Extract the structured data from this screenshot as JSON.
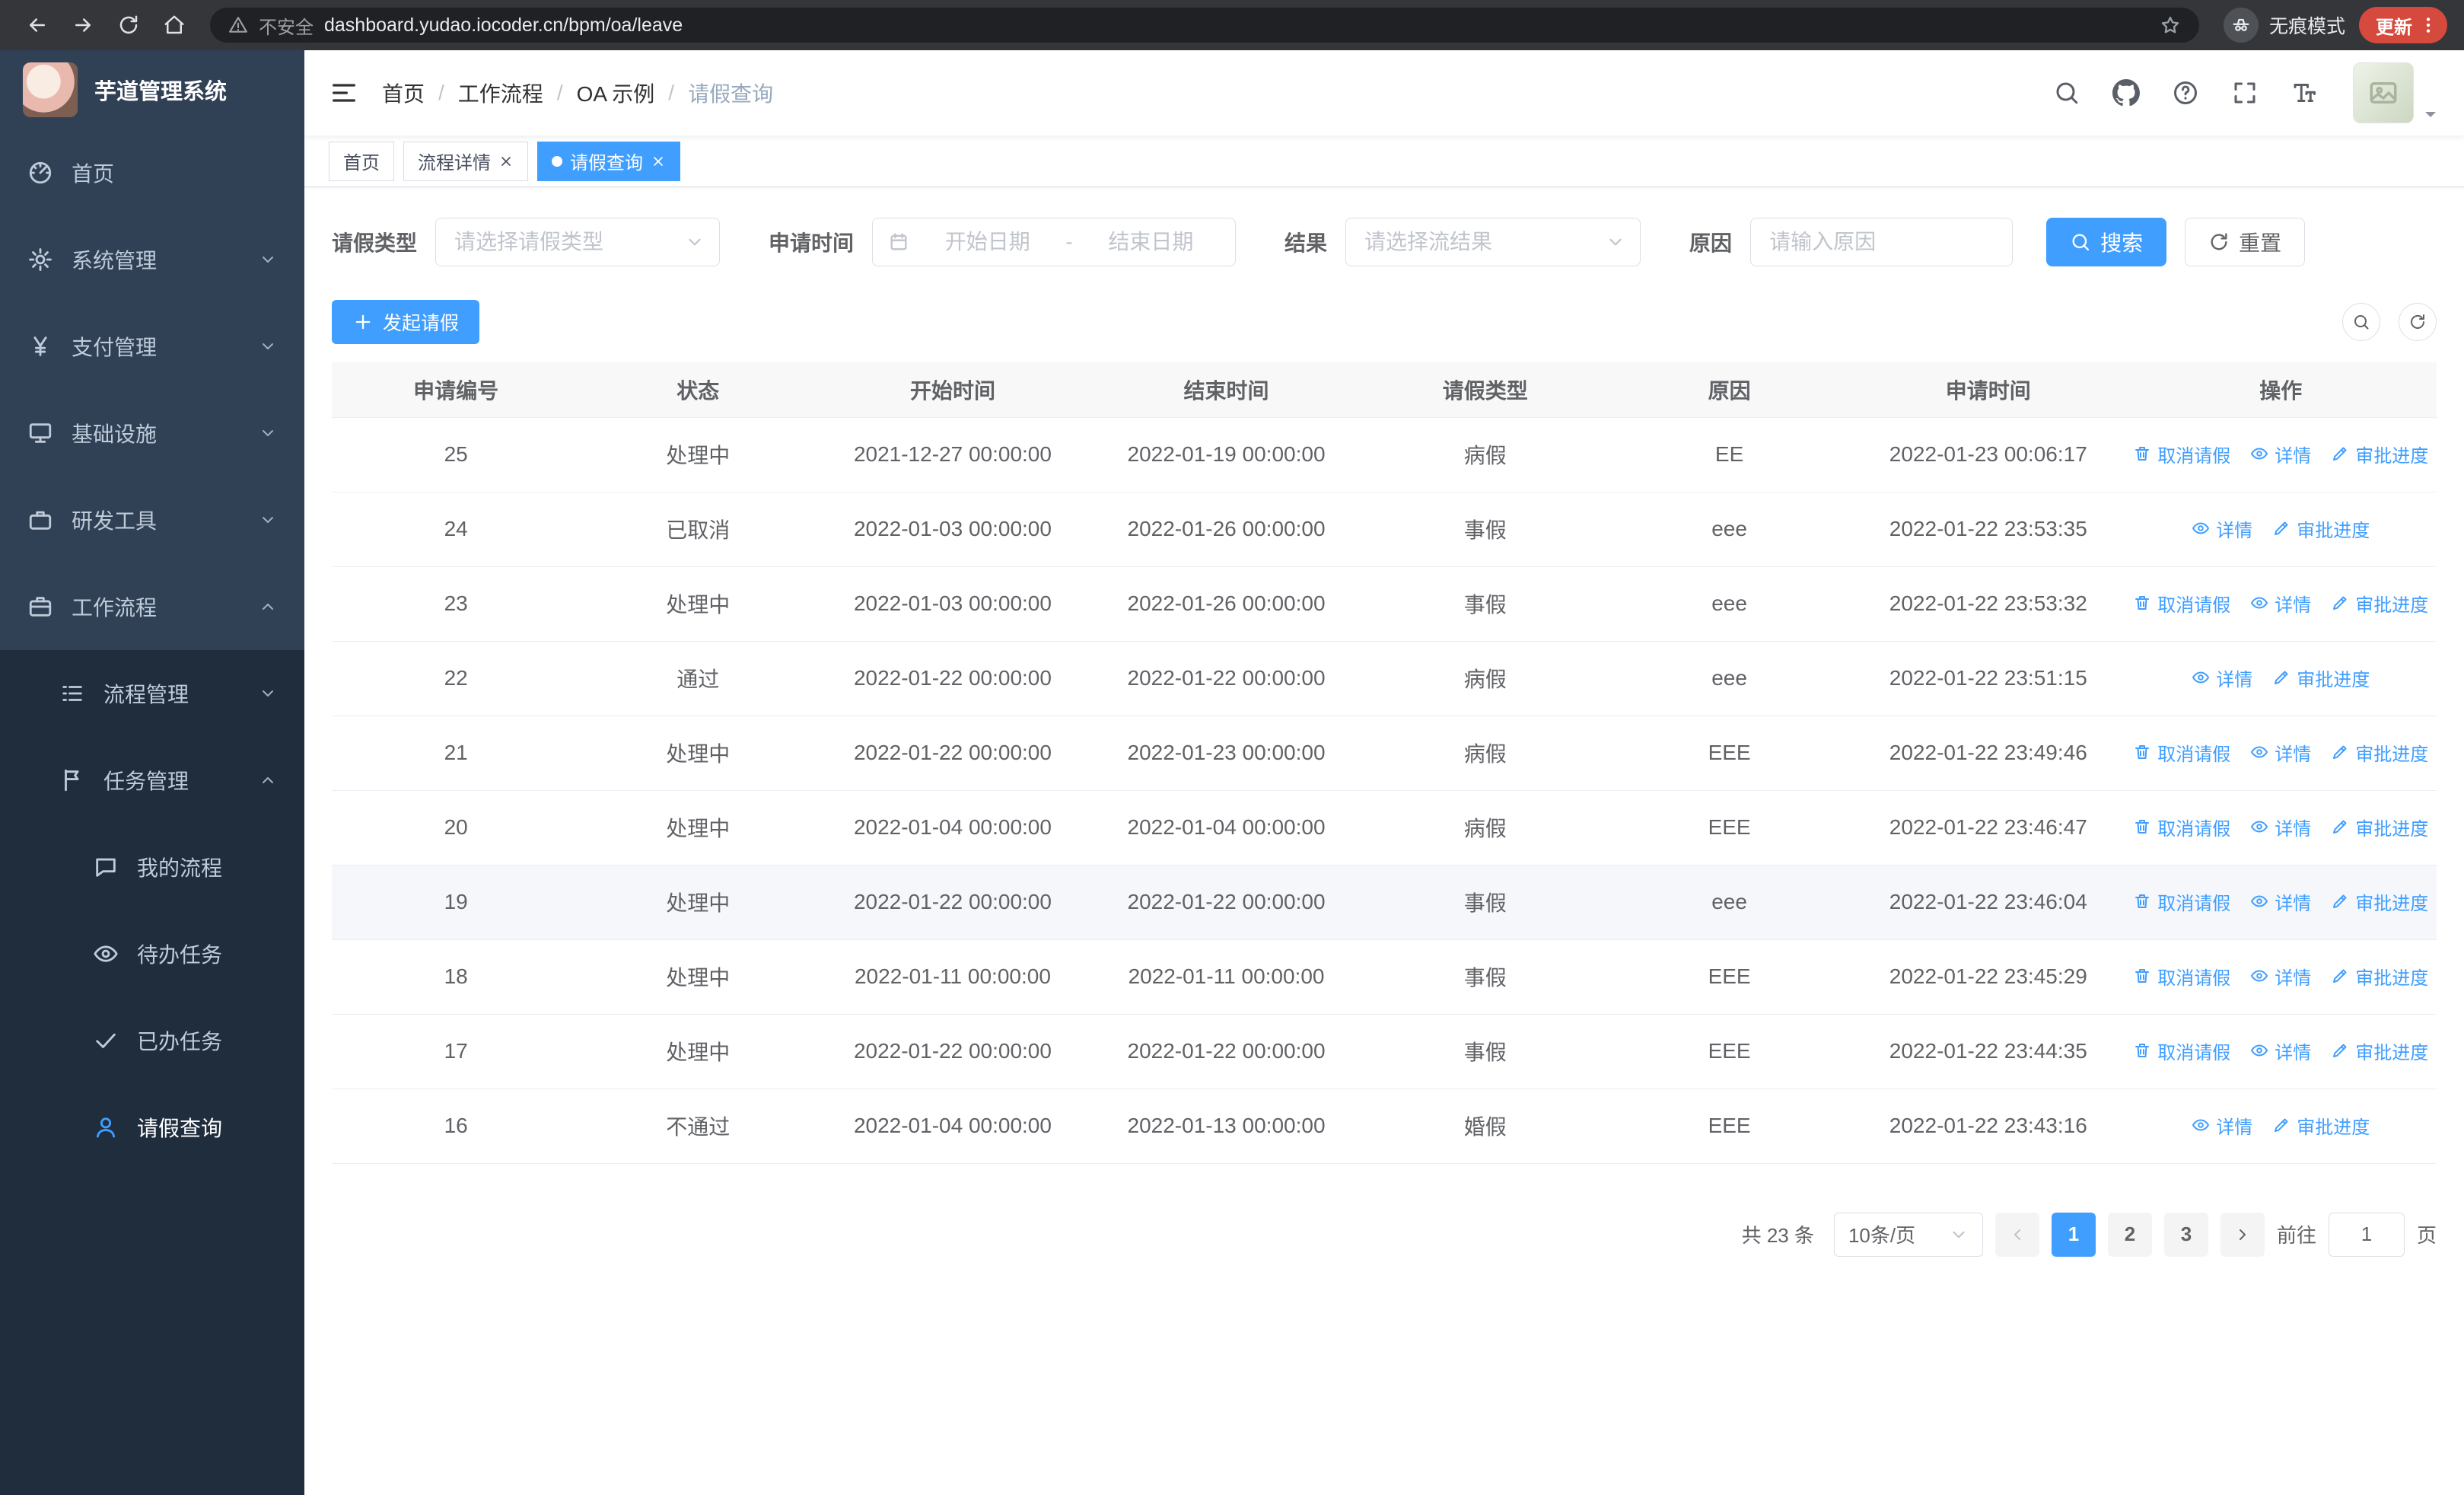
{
  "browser": {
    "warning": "不安全",
    "url": "dashboard.yudao.iocoder.cn/bpm/oa/leave",
    "incognito": "无痕模式",
    "update": "更新"
  },
  "sidebar": {
    "title": "芋道管理系统",
    "menu": [
      {
        "key": "home",
        "label": "首页",
        "icon": "dashboard-icon",
        "level": 1
      },
      {
        "key": "system",
        "label": "系统管理",
        "icon": "gear-icon",
        "level": 1,
        "arrow": true
      },
      {
        "key": "payment",
        "label": "支付管理",
        "icon": "yen-icon",
        "level": 1,
        "arrow": true
      },
      {
        "key": "infra",
        "label": "基础设施",
        "icon": "monitor-icon",
        "level": 1,
        "arrow": true
      },
      {
        "key": "devtools",
        "label": "研发工具",
        "icon": "briefcase-icon",
        "level": 1,
        "arrow": true
      },
      {
        "key": "workflow",
        "label": "工作流程",
        "icon": "suitcase-icon",
        "level": 1,
        "arrow": true,
        "open": true
      },
      {
        "key": "process-mgmt",
        "label": "流程管理",
        "icon": "list-icon",
        "level": 2,
        "arrow": true
      },
      {
        "key": "task-mgmt",
        "label": "任务管理",
        "icon": "flag-icon",
        "level": 2,
        "arrow": true,
        "open": true
      },
      {
        "key": "my-process",
        "label": "我的流程",
        "icon": "chat-icon",
        "level": 3
      },
      {
        "key": "todo-tasks",
        "label": "待办任务",
        "icon": "eye-icon",
        "level": 3
      },
      {
        "key": "done-tasks",
        "label": "已办任务",
        "icon": "check-icon",
        "level": 3
      },
      {
        "key": "leave-query",
        "label": "请假查询",
        "icon": "user-icon",
        "level": 3,
        "active": true
      }
    ]
  },
  "header": {
    "breadcrumb": [
      "首页",
      "工作流程",
      "OA 示例",
      "请假查询"
    ],
    "separator": "/"
  },
  "tabs": [
    {
      "label": "首页"
    },
    {
      "label": "流程详情",
      "closable": true
    },
    {
      "label": "请假查询",
      "closable": true,
      "active": true
    }
  ],
  "filters": {
    "type_label": "请假类型",
    "type_placeholder": "请选择请假类型",
    "time_label": "申请时间",
    "time_start_placeholder": "开始日期",
    "time_separator": "-",
    "time_end_placeholder": "结束日期",
    "result_label": "结果",
    "result_placeholder": "请选择流结果",
    "reason_label": "原因",
    "reason_placeholder": "请输入原因",
    "search_button": "搜索",
    "reset_button": "重置"
  },
  "toolbar": {
    "create_button": "发起请假"
  },
  "table": {
    "columns": [
      "申请编号",
      "状态",
      "开始时间",
      "结束时间",
      "请假类型",
      "原因",
      "申请时间",
      "操作"
    ],
    "op_labels": {
      "cancel": "取消请假",
      "detail": "详情",
      "progress": "审批进度"
    },
    "rows": [
      {
        "id": "25",
        "status": "处理中",
        "start": "2021-12-27 00:00:00",
        "end": "2022-01-19 00:00:00",
        "type": "病假",
        "reason": "EE",
        "applied": "2022-01-23 00:06:17",
        "ops": [
          "cancel",
          "detail",
          "progress"
        ]
      },
      {
        "id": "24",
        "status": "已取消",
        "start": "2022-01-03 00:00:00",
        "end": "2022-01-26 00:00:00",
        "type": "事假",
        "reason": "eee",
        "applied": "2022-01-22 23:53:35",
        "ops": [
          "detail",
          "progress"
        ]
      },
      {
        "id": "23",
        "status": "处理中",
        "start": "2022-01-03 00:00:00",
        "end": "2022-01-26 00:00:00",
        "type": "事假",
        "reason": "eee",
        "applied": "2022-01-22 23:53:32",
        "ops": [
          "cancel",
          "detail",
          "progress"
        ]
      },
      {
        "id": "22",
        "status": "通过",
        "start": "2022-01-22 00:00:00",
        "end": "2022-01-22 00:00:00",
        "type": "病假",
        "reason": "eee",
        "applied": "2022-01-22 23:51:15",
        "ops": [
          "detail",
          "progress"
        ]
      },
      {
        "id": "21",
        "status": "处理中",
        "start": "2022-01-22 00:00:00",
        "end": "2022-01-23 00:00:00",
        "type": "病假",
        "reason": "EEE",
        "applied": "2022-01-22 23:49:46",
        "ops": [
          "cancel",
          "detail",
          "progress"
        ]
      },
      {
        "id": "20",
        "status": "处理中",
        "start": "2022-01-04 00:00:00",
        "end": "2022-01-04 00:00:00",
        "type": "病假",
        "reason": "EEE",
        "applied": "2022-01-22 23:46:47",
        "ops": [
          "cancel",
          "detail",
          "progress"
        ]
      },
      {
        "id": "19",
        "status": "处理中",
        "start": "2022-01-22 00:00:00",
        "end": "2022-01-22 00:00:00",
        "type": "事假",
        "reason": "eee",
        "applied": "2022-01-22 23:46:04",
        "ops": [
          "cancel",
          "detail",
          "progress"
        ],
        "hover": true
      },
      {
        "id": "18",
        "status": "处理中",
        "start": "2022-01-11 00:00:00",
        "end": "2022-01-11 00:00:00",
        "type": "事假",
        "reason": "EEE",
        "applied": "2022-01-22 23:45:29",
        "ops": [
          "cancel",
          "detail",
          "progress"
        ]
      },
      {
        "id": "17",
        "status": "处理中",
        "start": "2022-01-22 00:00:00",
        "end": "2022-01-22 00:00:00",
        "type": "事假",
        "reason": "EEE",
        "applied": "2022-01-22 23:44:35",
        "ops": [
          "cancel",
          "detail",
          "progress"
        ]
      },
      {
        "id": "16",
        "status": "不通过",
        "start": "2022-01-04 00:00:00",
        "end": "2022-01-13 00:00:00",
        "type": "婚假",
        "reason": "EEE",
        "applied": "2022-01-22 23:43:16",
        "ops": [
          "detail",
          "progress"
        ]
      }
    ]
  },
  "pagination": {
    "total": "共 23 条",
    "page_size": "10条/页",
    "pages": [
      "1",
      "2",
      "3"
    ],
    "current": "1",
    "goto_label": "前往",
    "goto_value": "1",
    "goto_suffix": "页"
  },
  "colors": {
    "primary": "#409EFF",
    "sidebar_bg": "#304156",
    "sidebar_sub_bg": "#1f2d3d"
  }
}
